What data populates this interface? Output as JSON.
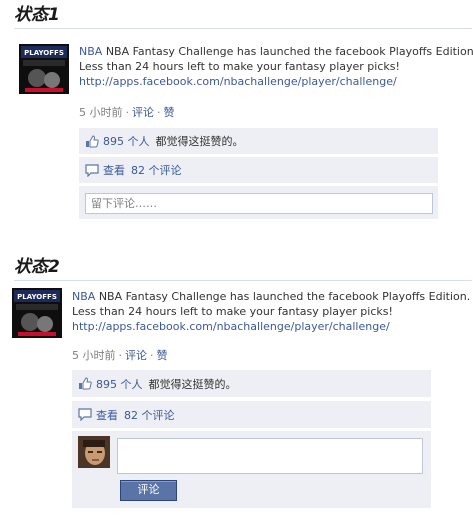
{
  "states": [
    {
      "heading": "状态1",
      "author": "NBA",
      "message_line1": "NBA Fantasy Challenge has launched the facebook Playoffs Edition.",
      "message_line2": "Less than 24 hours left to make your fantasy player picks!",
      "link_url": "http://apps.facebook.com/nbachallenge/player/challenge/",
      "time": "5 小时前",
      "comment_action": "评论",
      "like_action": "赞",
      "likes_count": "895 个人",
      "likes_text": "都觉得这挺赞的。",
      "view_label": "查看",
      "comments_count": "82 个评论",
      "comment_placeholder": "留下评论……"
    },
    {
      "heading": "状态2",
      "author": "NBA",
      "message_line1": "NBA Fantasy Challenge has launched the facebook Playoffs Edition.",
      "message_line2": "Less than 24 hours left to make your fantasy player picks!",
      "link_url": "http://apps.facebook.com/nbachallenge/player/challenge/",
      "time": "5 小时前",
      "comment_action": "评论",
      "like_action": "赞",
      "likes_count": "895 个人",
      "likes_text": "都觉得这挺赞的。",
      "view_label": "查看",
      "comments_count": "82 个评论",
      "comment_value": "",
      "submit_label": "评论"
    }
  ],
  "avatar_logo_text": "PLAYOFFS",
  "icons": {
    "like": "thumbs-up-icon",
    "comments": "speech-bubble-icon"
  },
  "colors": {
    "link": "#3b5998",
    "ufi_background": "#edeff4",
    "button": "#5b74a8"
  }
}
